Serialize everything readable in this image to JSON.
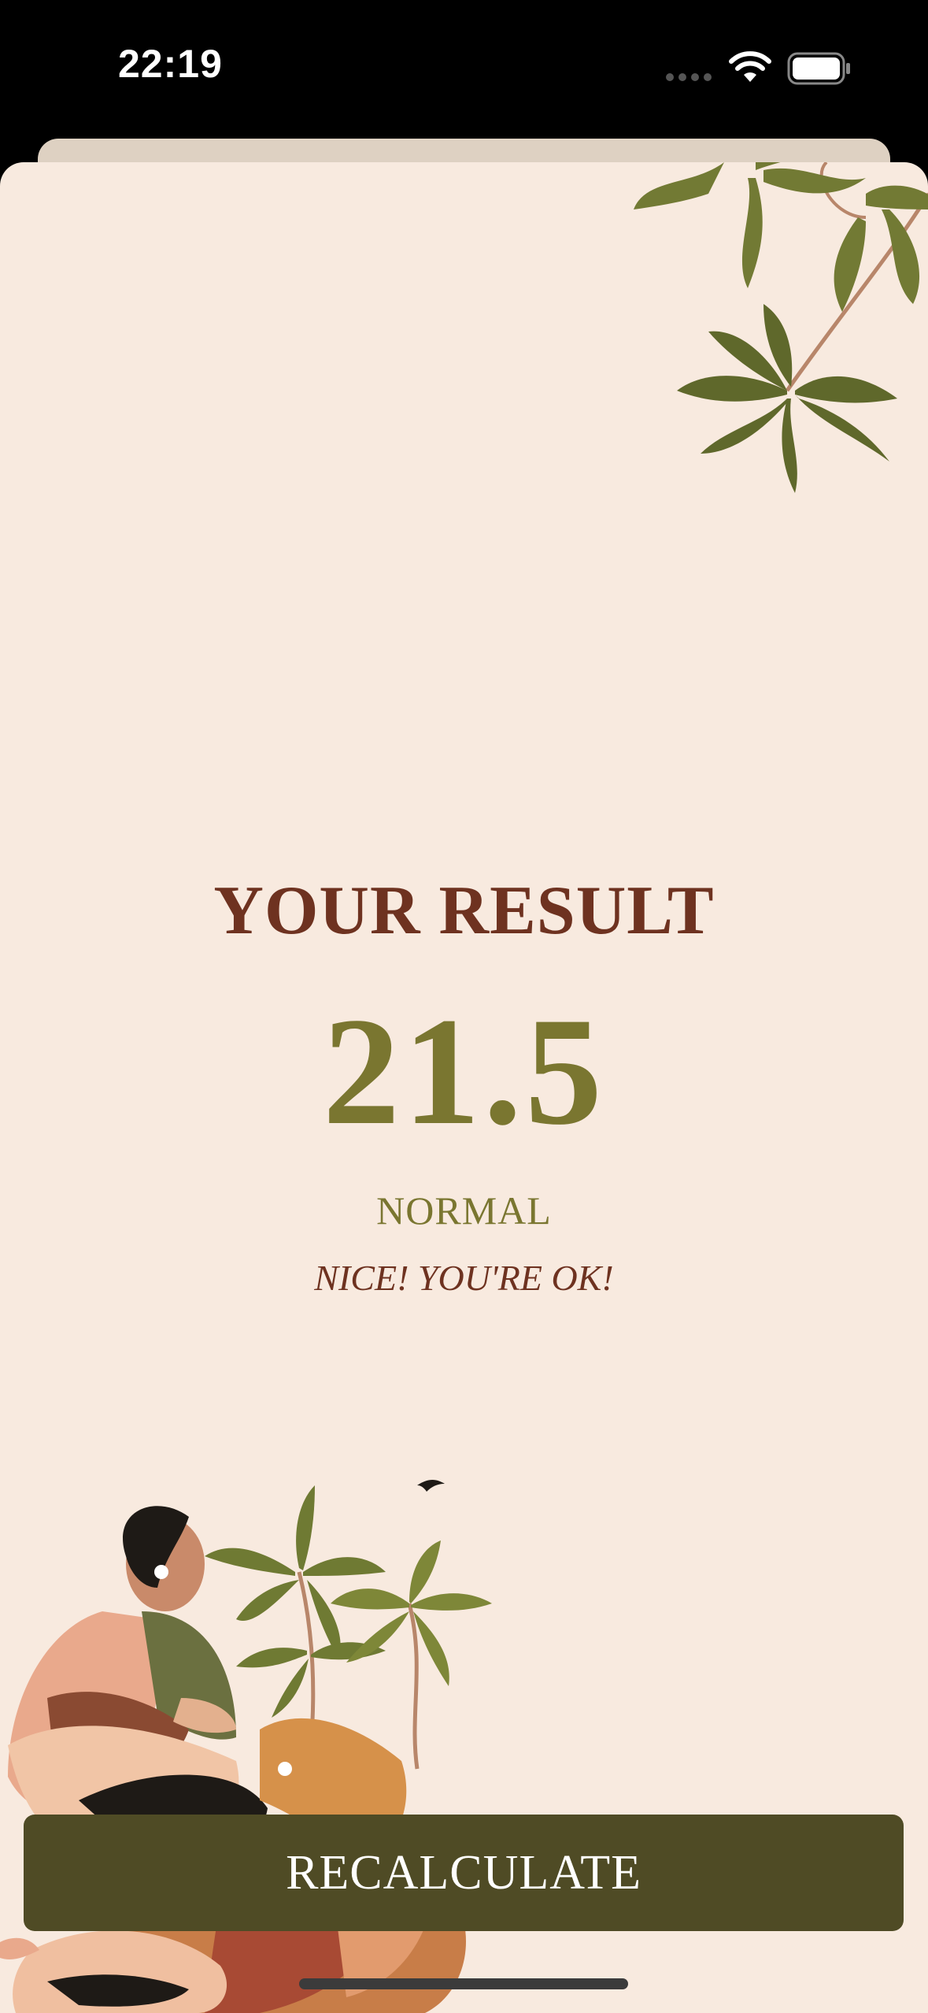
{
  "status_bar": {
    "time": "22:19",
    "icons": [
      "cellular-signal-icon",
      "wifi-icon",
      "battery-icon"
    ]
  },
  "result": {
    "title": "YOUR RESULT",
    "value": "21.5",
    "category": "NORMAL",
    "message": "NICE! YOU'RE OK!"
  },
  "actions": {
    "recalculate_label": "RECALCULATE"
  },
  "colors": {
    "card_background": "#f8eadf",
    "title_color": "#6e3220",
    "value_color": "#7a7630",
    "button_background": "#4f4b25"
  },
  "illustrations": [
    "plant-illustration",
    "seated-women-plants-illustration"
  ]
}
